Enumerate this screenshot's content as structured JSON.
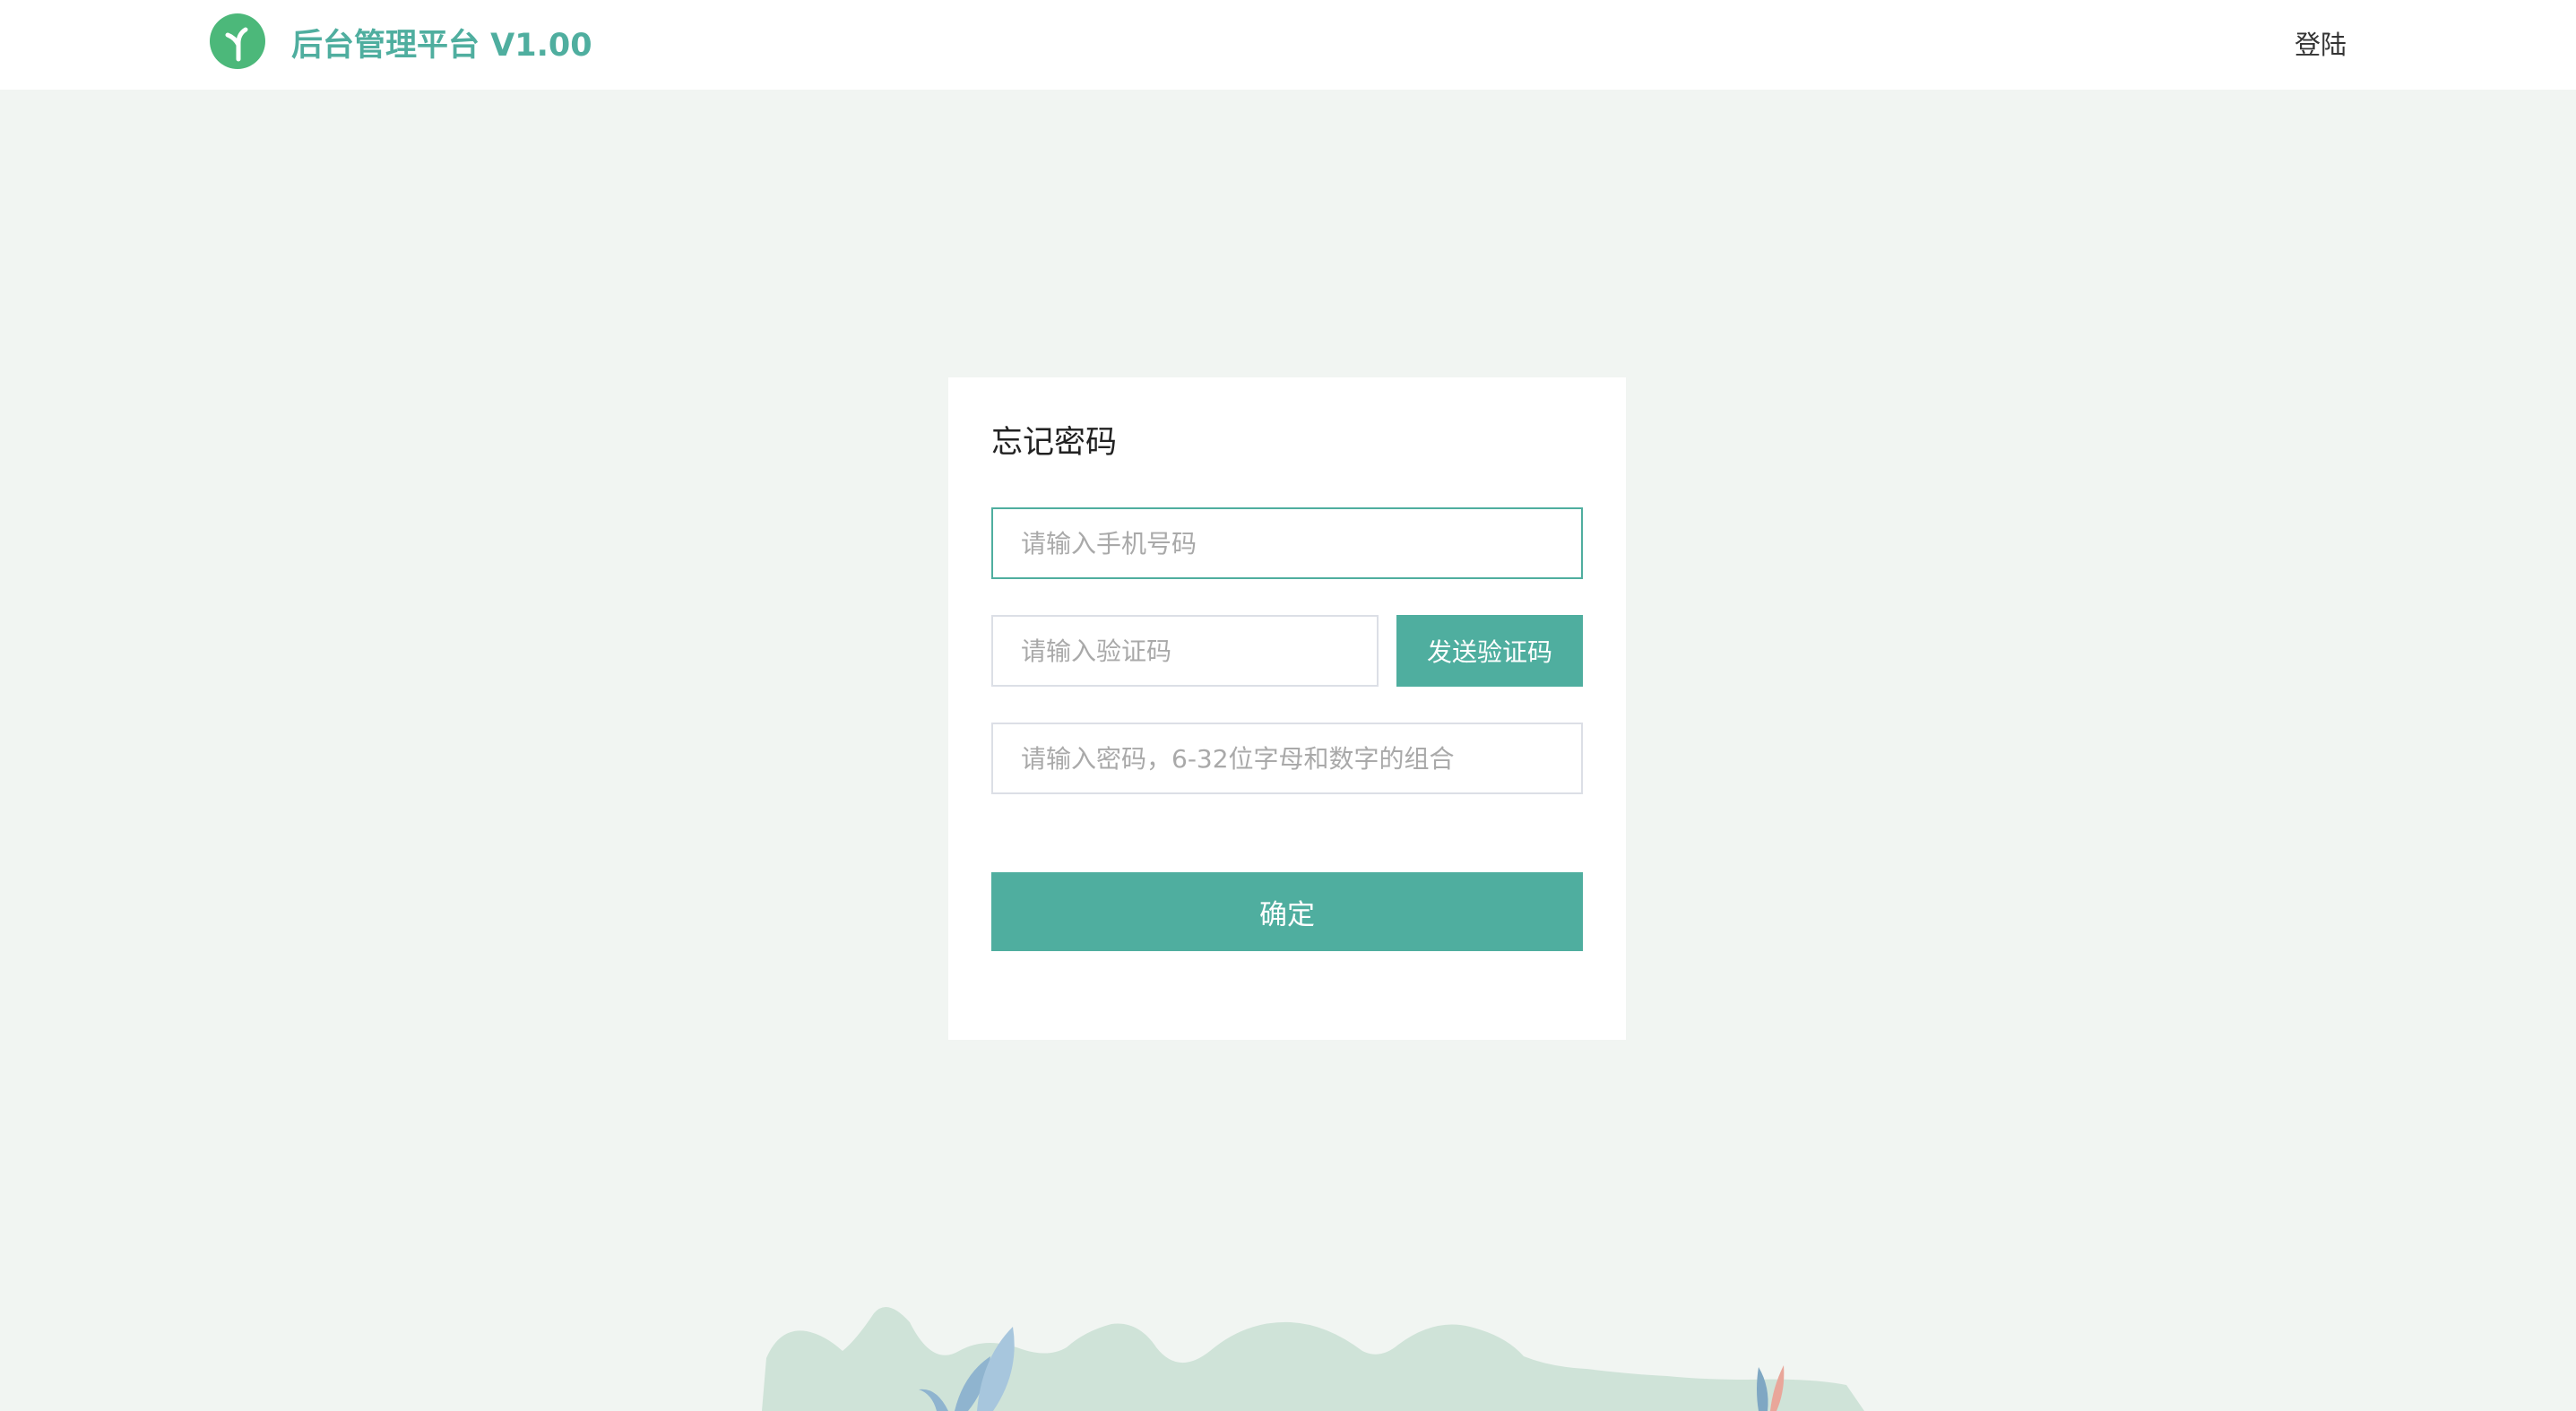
{
  "header": {
    "logo_icon": "sprout-logo-icon",
    "brand_title": "后台管理平台 V1.00",
    "login_link": "登陆"
  },
  "form": {
    "title": "忘记密码",
    "phone_placeholder": "请输入手机号码",
    "code_placeholder": "请输入验证码",
    "send_code_label": "发送验证码",
    "password_placeholder": "请输入密码，6-32位字母和数字的组合",
    "submit_label": "确定"
  },
  "colors": {
    "accent": "#4fae9f",
    "background": "#f1f5f2",
    "logo_green": "#4cb87a",
    "hills": "#cfe3d8"
  }
}
